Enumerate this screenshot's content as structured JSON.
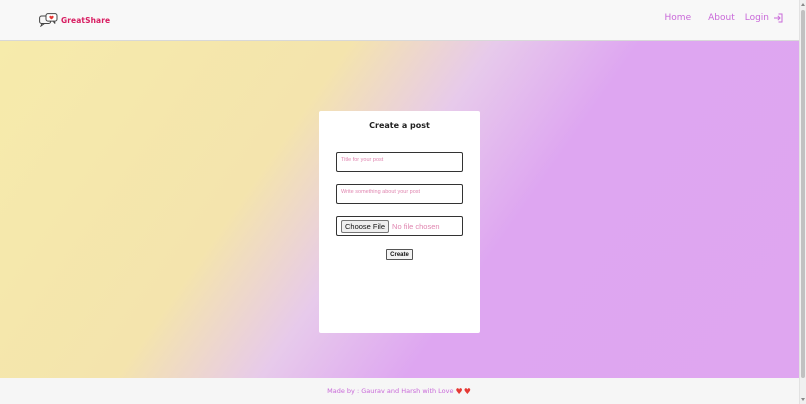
{
  "header": {
    "logo_text": "GreatShare",
    "nav": {
      "home": "Home",
      "about": "About",
      "login": "Login"
    }
  },
  "card": {
    "title": "Create a post",
    "title_placeholder": "Title for your post",
    "description_placeholder": "Write something about your post",
    "choose_file_label": "Choose File",
    "file_status": "No file chosen",
    "create_label": "Create"
  },
  "footer": {
    "text": "Made by : Gaurav and Harsh with Love",
    "hearts": "♥♥"
  },
  "colors": {
    "brand": "#d81b60",
    "nav": "#c969d9",
    "placeholder": "#e086b0",
    "gradient_start": "#f6ebab",
    "gradient_end": "#dfa6f0"
  },
  "icons": [
    "chat-bubbles-logo-icon",
    "login-arrow-icon",
    "heart-icon"
  ]
}
